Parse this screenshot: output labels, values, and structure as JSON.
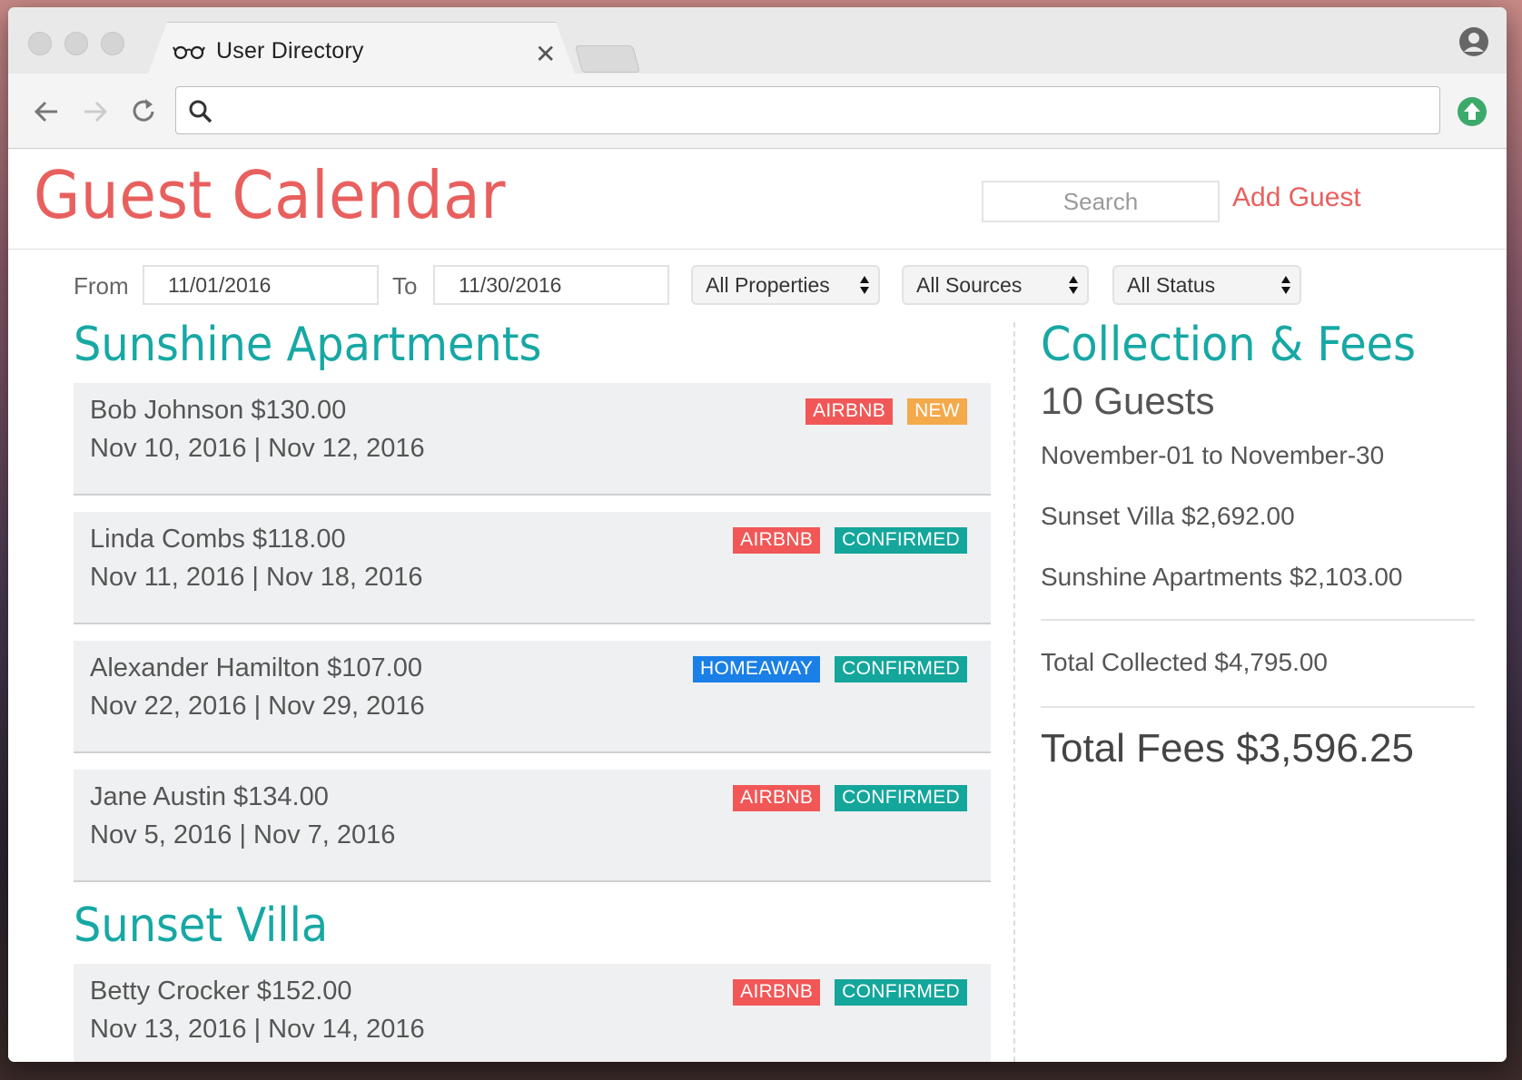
{
  "browser": {
    "tab_title": "User Directory",
    "omnibox_value": ""
  },
  "header": {
    "title": "Guest Calendar",
    "search_placeholder": "Search",
    "add_guest_label": "Add Guest"
  },
  "filters": {
    "from_label": "From",
    "from_value": "11/01/2016",
    "to_label": "To",
    "to_value": "11/30/2016",
    "properties": "All Properties",
    "sources": "All Sources",
    "status": "All Status"
  },
  "colors": {
    "accent_red": "#e8605e",
    "teal": "#17a8a4",
    "airbnb": "#f25757",
    "homeaway": "#1a7fe6",
    "confirmed": "#14a69b",
    "new": "#f4a94a"
  },
  "properties": [
    {
      "name": "Sunshine Apartments",
      "guests": [
        {
          "name": "Bob Johnson",
          "amount": "$130.00",
          "dates": "Nov 10, 2016 | Nov 12, 2016",
          "source": "AIRBNB",
          "status": "NEW"
        },
        {
          "name": "Linda Combs",
          "amount": "$118.00",
          "dates": "Nov 11, 2016 | Nov 18, 2016",
          "source": "AIRBNB",
          "status": "CONFIRMED"
        },
        {
          "name": "Alexander Hamilton",
          "amount": "$107.00",
          "dates": "Nov 22, 2016 | Nov 29, 2016",
          "source": "HOMEAWAY",
          "status": "CONFIRMED"
        },
        {
          "name": "Jane Austin",
          "amount": "$134.00",
          "dates": "Nov 5, 2016 | Nov 7, 2016",
          "source": "AIRBNB",
          "status": "CONFIRMED"
        }
      ]
    },
    {
      "name": "Sunset Villa",
      "guests": [
        {
          "name": "Betty Crocker",
          "amount": "$152.00",
          "dates": "Nov 13, 2016 | Nov 14, 2016",
          "source": "AIRBNB",
          "status": "CONFIRMED"
        }
      ]
    }
  ],
  "summary": {
    "title": "Collection & Fees",
    "guests_count": "10 Guests",
    "range": "November-01 to November-30",
    "per_property": [
      {
        "label": "Sunset Villa $2,692.00"
      },
      {
        "label": "Sunshine Apartments $2,103.00"
      }
    ],
    "total_collected": "Total Collected $4,795.00",
    "total_fees_label": "Total Fees",
    "total_fees_value": "$3,596.25"
  }
}
